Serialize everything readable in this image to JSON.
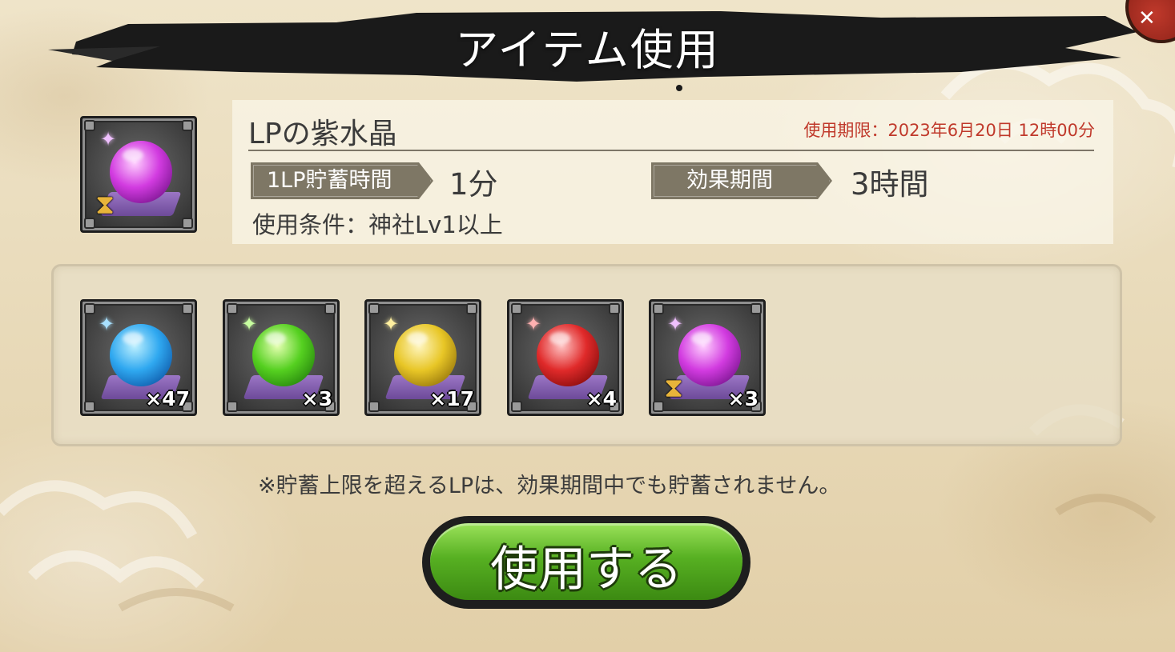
{
  "title": "アイテム使用",
  "close_icon": "close-icon",
  "item": {
    "name": "LPの紫水晶",
    "expiry": "使用期限：2023年6月20日 12時00分",
    "lp_time_label": "1LP貯蓄時間",
    "lp_time_value": "1分",
    "effect_label": "効果期間",
    "effect_value": "3時間",
    "condition": "使用条件：神社Lv1以上"
  },
  "inventory": [
    {
      "name": "blue-crystal",
      "quantity": "×47",
      "color": "#2fa8f0",
      "timed": false
    },
    {
      "name": "green-crystal",
      "quantity": "×3",
      "color": "#55d020",
      "timed": false
    },
    {
      "name": "yellow-crystal",
      "quantity": "×17",
      "color": "#e8c626",
      "timed": false
    },
    {
      "name": "red-crystal",
      "quantity": "×4",
      "color": "#e02a2a",
      "timed": false
    },
    {
      "name": "purple-crystal",
      "quantity": "×3",
      "color": "#d23be0",
      "timed": true
    }
  ],
  "note": "※貯蓄上限を超えるLPは、効果期間中でも貯蓄されません。",
  "use_button": "使用する",
  "colors": {
    "expiry_text": "#c0392b",
    "tag_bg": "#7e7765",
    "button_green": "#57b022"
  }
}
